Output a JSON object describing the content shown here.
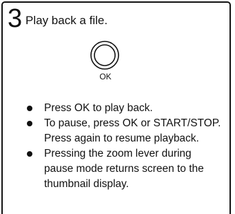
{
  "step": {
    "number": "3",
    "title": "Play back a file."
  },
  "ok_button": {
    "label": "OK",
    "icon": "ok-button-icon"
  },
  "bullets": [
    {
      "lines": [
        "Press OK to play back."
      ]
    },
    {
      "lines": [
        "To pause, press OK or START/STOP.",
        "Press again to resume playback."
      ]
    },
    {
      "lines": [
        "Pressing the zoom lever during",
        "pause mode returns screen to the",
        "thumbnail display."
      ]
    }
  ]
}
